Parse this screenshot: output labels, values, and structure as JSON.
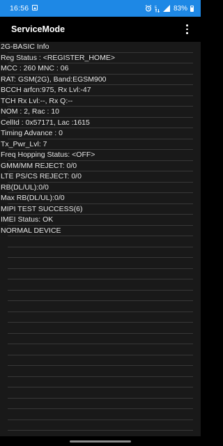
{
  "status_bar": {
    "time": "16:56",
    "battery_percent": "83%",
    "icons": [
      "gallery-icon",
      "alarm-icon",
      "data-icon",
      "signal-icon",
      "battery-icon"
    ]
  },
  "app_bar": {
    "title": "ServiceMode",
    "menu_icon": "more-vert-icon"
  },
  "lines": [
    "2G-BASIC Info",
    "Reg Status : <REGISTER_HOME>",
    "MCC : 260 MNC : 06",
    "RAT: GSM(2G), Band:EGSM900",
    "BCCH arfcn:975, Rx Lvl:-47",
    "TCH Rx Lvl:--, Rx Q:--",
    "NOM : 2, Rac : 10",
    "CellId : 0x57171, Lac :1615",
    "Timing Advance : 0",
    "Tx_Pwr_Lvl: 7",
    "Freq Hopping Status: <OFF>",
    "GMM/MM REJECT: 0/0",
    "LTE PS/CS REJECT: 0/0",
    "RB(DL/UL):0/0",
    "Max RB(DL/UL):0/0",
    "MIPI TEST SUCCESS(6)",
    "IMEI Status: OK",
    "NORMAL DEVICE"
  ],
  "colors": {
    "status_bar_bg": "#1e88e5",
    "app_bar_bg": "#000000",
    "list_bg": "#191919",
    "text": "#e6e6e6",
    "divider": "#383838"
  }
}
